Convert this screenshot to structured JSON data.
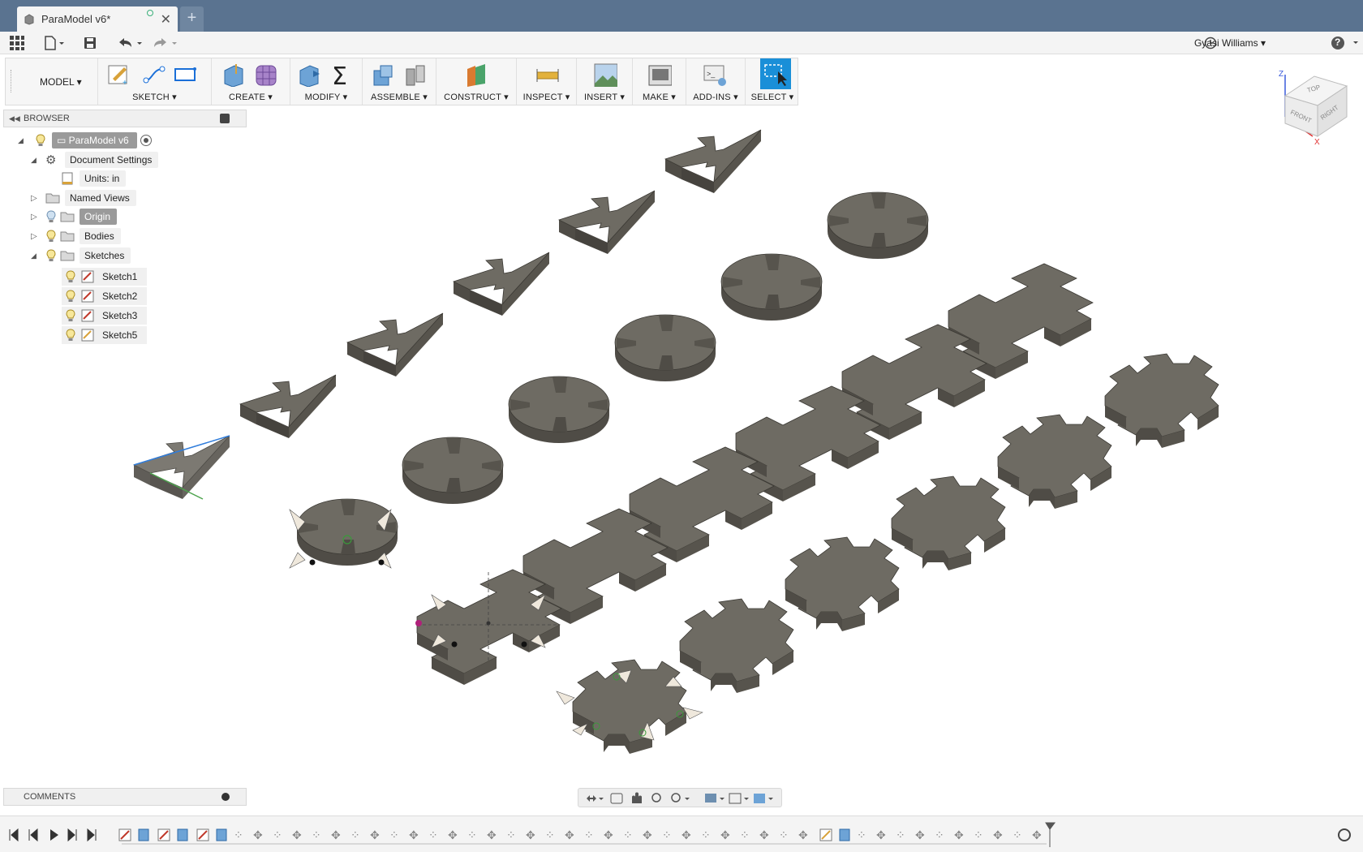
{
  "window": {
    "tab_title": "ParaModel v6*",
    "new_tab": "+",
    "close_glyph": "✕"
  },
  "qat": {
    "user": "Gyasi Williams",
    "help": "?"
  },
  "ribbon": {
    "workspace": "MODEL",
    "groups": [
      "SKETCH",
      "CREATE",
      "MODIFY",
      "ASSEMBLE",
      "CONSTRUCT",
      "INSPECT",
      "INSERT",
      "MAKE",
      "ADD-INS",
      "SELECT"
    ]
  },
  "browser": {
    "title": "BROWSER",
    "root": "ParaModel v6",
    "items": {
      "doc_settings": "Document Settings",
      "units": "Units: in",
      "named_views": "Named Views",
      "origin": "Origin",
      "bodies": "Bodies",
      "sketches": "Sketches",
      "sketch1": "Sketch1",
      "sketch2": "Sketch2",
      "sketch3": "Sketch3",
      "sketch5": "Sketch5"
    }
  },
  "comments": {
    "title": "COMMENTS"
  },
  "viewcube": {
    "top": "TOP",
    "front": "FRONT",
    "right": "RIGHT",
    "z": "Z",
    "x": "X"
  },
  "colors": {
    "titlebar": "#5a7390",
    "body_top": "#6e6b63",
    "body_side": "#4f4c46",
    "accent": "#1a8fd8"
  }
}
